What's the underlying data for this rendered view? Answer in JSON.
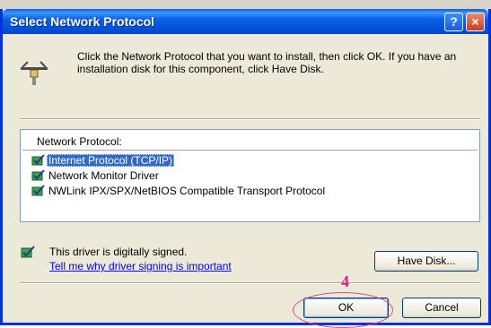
{
  "window": {
    "title": "Select Network Protocol",
    "help_glyph": "?",
    "close_glyph": "×"
  },
  "instructions": "Click the Network Protocol that you want to install, then click OK. If you have an installation disk for this component, click Have Disk.",
  "list": {
    "header": "Network Protocol:",
    "items": [
      {
        "label": "Internet Protocol (TCP/IP)",
        "selected": true,
        "icon": "protocol-icon"
      },
      {
        "label": "Network Monitor Driver",
        "selected": false,
        "icon": "protocol-icon"
      },
      {
        "label": "NWLink IPX/SPX/NetBIOS Compatible Transport Protocol",
        "selected": false,
        "icon": "protocol-icon"
      }
    ]
  },
  "signing": {
    "status": "This driver is digitally signed.",
    "link": "Tell me why driver signing is important",
    "icon": "signed-driver-icon"
  },
  "buttons": {
    "have_disk": "Have Disk...",
    "ok": "OK",
    "cancel": "Cancel"
  },
  "annotation": {
    "step": "4",
    "color": "#e11b8b"
  },
  "colors": {
    "titlebar": "#0a5fe0",
    "selection": "#316ac5",
    "link": "#0000ff",
    "dialog_bg": "#ece9d8"
  }
}
